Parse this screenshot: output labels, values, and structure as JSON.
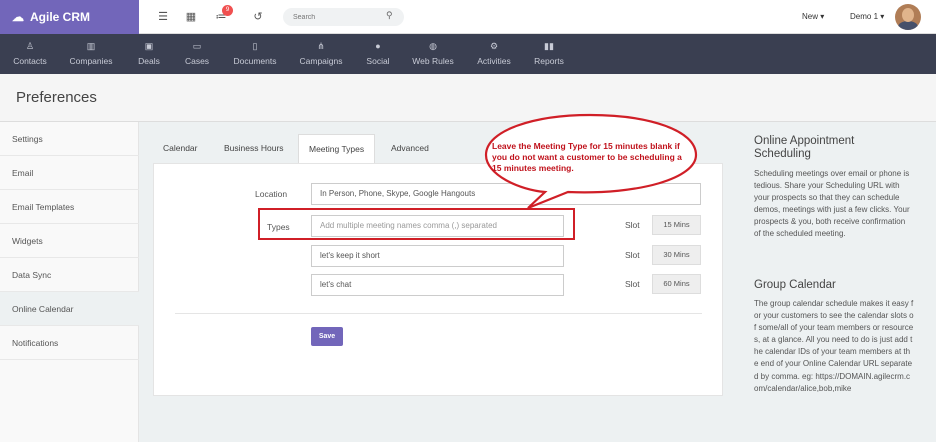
{
  "topbar": {
    "brand": "Agile CRM",
    "notification_count": "9",
    "search_placeholder": "Search",
    "new_label": "New ▾",
    "user_label": "Demo 1 ▾"
  },
  "nav": [
    {
      "label": "Contacts",
      "icon": "user-icon"
    },
    {
      "label": "Companies",
      "icon": "building-icon"
    },
    {
      "label": "Deals",
      "icon": "money-icon"
    },
    {
      "label": "Cases",
      "icon": "folder-icon"
    },
    {
      "label": "Documents",
      "icon": "file-icon"
    },
    {
      "label": "Campaigns",
      "icon": "sitemap-icon"
    },
    {
      "label": "Social",
      "icon": "comments-icon"
    },
    {
      "label": "Web Rules",
      "icon": "globe-icon"
    },
    {
      "label": "Activities",
      "icon": "gears-icon"
    },
    {
      "label": "Reports",
      "icon": "bar-chart-icon"
    }
  ],
  "page_title": "Preferences",
  "left_menu": [
    {
      "label": "Settings"
    },
    {
      "label": "Email"
    },
    {
      "label": "Email Templates"
    },
    {
      "label": "Widgets"
    },
    {
      "label": "Data Sync"
    },
    {
      "label": "Online Calendar",
      "active": true
    },
    {
      "label": "Notifications"
    }
  ],
  "tabs": [
    {
      "label": "Calendar"
    },
    {
      "label": "Business Hours"
    },
    {
      "label": "Meeting Types",
      "active": true
    },
    {
      "label": "Advanced"
    }
  ],
  "form": {
    "location_label": "Location",
    "location_value": "In Person, Phone, Skype, Google Hangouts",
    "types_label": "Types",
    "types_placeholder": "Add multiple meeting names comma (,) separated",
    "slot_label": "Slot",
    "rows": [
      {
        "value": "",
        "slot": "15 Mins"
      },
      {
        "value": "let's keep it short",
        "slot": "30 Mins"
      },
      {
        "value": "let's chat",
        "slot": "60 Mins"
      }
    ],
    "save_label": "Save"
  },
  "callout": {
    "text": "Leave the Meeting Type for 15 minutes blank if you do not want a customer to be scheduling a 15 minutes meeting.",
    "color": "#c0121c"
  },
  "help": {
    "title1": "Online Appointment Scheduling",
    "body1": "Scheduling meetings over email or phone is tedious. Share your Scheduling URL with your prospects so that they can schedule demos, meetings with just a few clicks. Your prospects & you, both receive confirmation of the scheduled meeting.",
    "title2": "Group Calendar",
    "body2": "The group calendar schedule makes it easy for your customers to see the calendar slots of some/all of your team members or resources, at a glance. All you need to do is just add the calendar IDs of your team members at the end of your Online Calendar URL separated by comma. eg: https://DOMAIN.agilecrm.com/calendar/alice,bob,mike"
  },
  "colors": {
    "brand": "#7266ba",
    "nav_bg": "#3a3f51",
    "highlight": "#d01f27"
  }
}
